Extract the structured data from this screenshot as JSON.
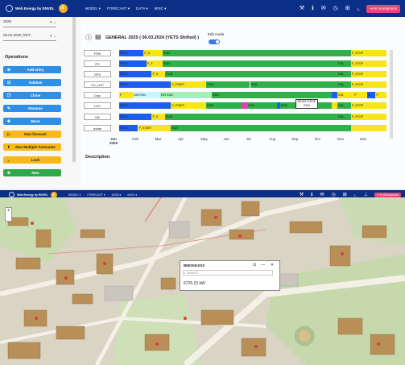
{
  "app": {
    "logo_text": "Web Energy by ENVEL",
    "badge": "E",
    "nav_items": [
      "MODEL",
      "FORECAST",
      "DATA",
      "MISC"
    ],
    "user_button": "Hi Anonymous"
  },
  "sidebar": {
    "year_select": "2025",
    "date_select": "06.03.2025 (YET..",
    "operations_title": "Operations",
    "buttons": [
      {
        "label": "Add entry",
        "icon": "plus-icon",
        "color": "blue"
      },
      {
        "label": "Validate",
        "icon": "check-icon",
        "color": "blue"
      },
      {
        "label": "Clone",
        "icon": "copy-icon",
        "color": "blue"
      },
      {
        "label": "Rename",
        "icon": "pen-icon",
        "color": "blue"
      },
      {
        "label": "Move",
        "icon": "move-icon",
        "color": "blue"
      },
      {
        "label": "Run forecast",
        "icon": "play-icon",
        "color": "yellow"
      },
      {
        "label": "Run Multiple Forecasts",
        "icon": "play-multi-icon",
        "color": "yellow"
      },
      {
        "label": "Lock",
        "icon": "lock-icon",
        "color": "yellow"
      },
      {
        "label": "New",
        "icon": "plus-icon",
        "color": "green"
      }
    ]
  },
  "main": {
    "title": "GENERAL 2025 ( 06.03.2024 (YETS Shifted) )",
    "edit_mode_label": "Edit mode",
    "months": [
      "Jan\n2025",
      "Feb",
      "Mar",
      "Apr",
      "May",
      "Jun",
      "Jul",
      "Aug",
      "Sep",
      "Oct",
      "Nov",
      "Dec"
    ],
    "tooltip": {
      "line1": "BEAM ISSUE",
      "line2": "RUN"
    },
    "description_label": "Description",
    "rows": [
      {
        "label": "PSB",
        "segs": [
          [
            "#ffffff",
            0,
            2,
            ""
          ],
          [
            "#1c5ef0",
            2,
            11,
            "YETS"
          ],
          [
            "#f7e51a",
            11,
            18,
            "P_S"
          ],
          [
            "#2fb048",
            18,
            87,
            "RUN"
          ],
          [
            "#f7e51a",
            87,
            100,
            "P_STOP"
          ]
        ]
      },
      {
        "label": "PS",
        "segs": [
          [
            "#ffffff",
            0,
            2,
            ""
          ],
          [
            "#1c5ef0",
            2,
            12,
            "YETS"
          ],
          [
            "#f7e51a",
            12,
            18,
            "P_S"
          ],
          [
            "#2fb048",
            18,
            82,
            "RUN"
          ],
          [
            "#2fb048",
            82,
            87,
            "ION_"
          ],
          [
            "#f7e51a",
            87,
            100,
            "P_STOP"
          ]
        ]
      },
      {
        "label": "SPS",
        "segs": [
          [
            "#ffffff",
            0,
            2,
            ""
          ],
          [
            "#1c5ef0",
            2,
            14,
            "YETS"
          ],
          [
            "#f7e51a",
            14,
            19,
            "P_S"
          ],
          [
            "#2fb048",
            19,
            82,
            "RUN"
          ],
          [
            "#2fb048",
            82,
            87,
            "ION_"
          ],
          [
            "#f7e51a",
            87,
            100,
            "P_STOP"
          ]
        ]
      },
      {
        "label": "CV_LHC",
        "segs": [
          [
            "#ffffff",
            0,
            2,
            ""
          ],
          [
            "#1c5ef0",
            2,
            21,
            "YETS"
          ],
          [
            "#f7e51a",
            21,
            34,
            "P_START"
          ],
          [
            "#2fb048",
            34,
            50,
            "RUN"
          ],
          [
            "#2fb048",
            50,
            82,
            "RUN"
          ],
          [
            "#2fb048",
            82,
            87,
            "ION_"
          ],
          [
            "#f7e51a",
            87,
            100,
            "P_STOP"
          ]
        ]
      },
      {
        "label": "Cryo",
        "segs": [
          [
            "#ffffff",
            0,
            2,
            ""
          ],
          [
            "#f7e51a",
            2,
            7,
            "P"
          ],
          [
            "#c8f5ff",
            7,
            17,
            "ION RUN"
          ],
          [
            "#a6f0b8",
            17,
            36,
            "ION RUN"
          ],
          [
            "#2fb048",
            36,
            80,
            "RUN"
          ],
          [
            "#1c5ef0",
            80,
            82,
            ""
          ],
          [
            "#f7e51a",
            82,
            88,
            "ION"
          ],
          [
            "#f7e51a",
            88,
            93,
            "P"
          ],
          [
            "#1c5ef0",
            93,
            96,
            "S"
          ],
          [
            "#f7e51a",
            96,
            100,
            "P"
          ]
        ]
      },
      {
        "label": "LHC",
        "segs": [
          [
            "#ffffff",
            0,
            2,
            ""
          ],
          [
            "#1c5ef0",
            2,
            21,
            "YETS"
          ],
          [
            "#f7e51a",
            21,
            34,
            "P_START"
          ],
          [
            "#2fb048",
            34,
            47,
            "RUN"
          ],
          [
            "#e23db4",
            47,
            49,
            ""
          ],
          [
            "#2fb048",
            49,
            60,
            "RUN"
          ],
          [
            "#1c5ef0",
            60,
            61,
            ""
          ],
          [
            "#2fb048",
            61,
            80,
            "RUN"
          ],
          [
            "#f7e51a",
            80,
            82,
            ""
          ],
          [
            "#2fb048",
            82,
            87,
            "ION_"
          ],
          [
            "#f7e51a",
            87,
            100,
            "P_STOP"
          ]
        ]
      },
      {
        "label": "NA",
        "segs": [
          [
            "#ffffff",
            0,
            2,
            ""
          ],
          [
            "#1c5ef0",
            2,
            14,
            "YETS"
          ],
          [
            "#f7e51a",
            14,
            19,
            "P_S"
          ],
          [
            "#2fb048",
            19,
            82,
            "RUN"
          ],
          [
            "#2fb048",
            82,
            87,
            "ION_"
          ],
          [
            "#f7e51a",
            87,
            100,
            "P_STOP"
          ]
        ]
      },
      {
        "label": "Isolde",
        "segs": [
          [
            "#ffffff",
            0,
            2,
            ""
          ],
          [
            "#1c5ef0",
            2,
            9,
            "YETS"
          ],
          [
            "#f7e51a",
            9,
            21,
            "P_START"
          ],
          [
            "#2fb048",
            21,
            87,
            "RUN"
          ],
          [
            "#f7e51a",
            87,
            100,
            ""
          ]
        ]
      }
    ]
  },
  "map": {
    "popup_title": "BMONG3/10",
    "popup_search": "Search",
    "popup_value": "6725.23 kW"
  },
  "colors": {
    "nav": "#0b2e86",
    "accent": "#e9457c"
  }
}
